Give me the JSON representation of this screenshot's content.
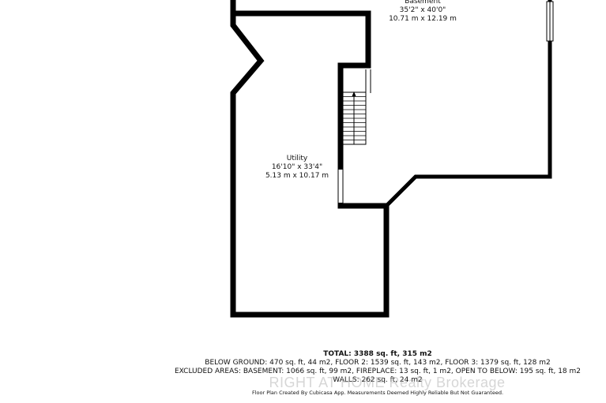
{
  "rooms": {
    "basement": {
      "name": "Basement",
      "imperial": "35'2\" x 40'0\"",
      "metric": "10.71 m x 12.19 m"
    },
    "utility": {
      "name": "Utility",
      "imperial": "16'10\" x 33'4\"",
      "metric": "5.13 m x 10.17 m"
    }
  },
  "summary": {
    "total": "TOTAL: 3388 sq. ft, 315 m2",
    "below_ground": "BELOW GROUND: 470 sq. ft, 44 m2, FLOOR 2: 1539 sq. ft, 143 m2, FLOOR 3: 1379 sq. ft, 128 m2",
    "excluded": "EXCLUDED AREAS: BASEMENT: 1066 sq. ft, 99 m2, FIREPLACE: 13 sq. ft, 1 m2, OPEN TO BELOW: 195 sq. ft, 18 m2",
    "walls": "WALLS: 262 sq. ft, 24 m2",
    "credit": "Floor Plan Created By Cubicasa App. Measurements Deemed Highly Reliable But Not Guaranteed."
  },
  "watermark": "RIGHT AT HOME Realty Brokerage",
  "colors": {
    "wall": "#000000",
    "background": "#ffffff",
    "text": "#111111"
  }
}
